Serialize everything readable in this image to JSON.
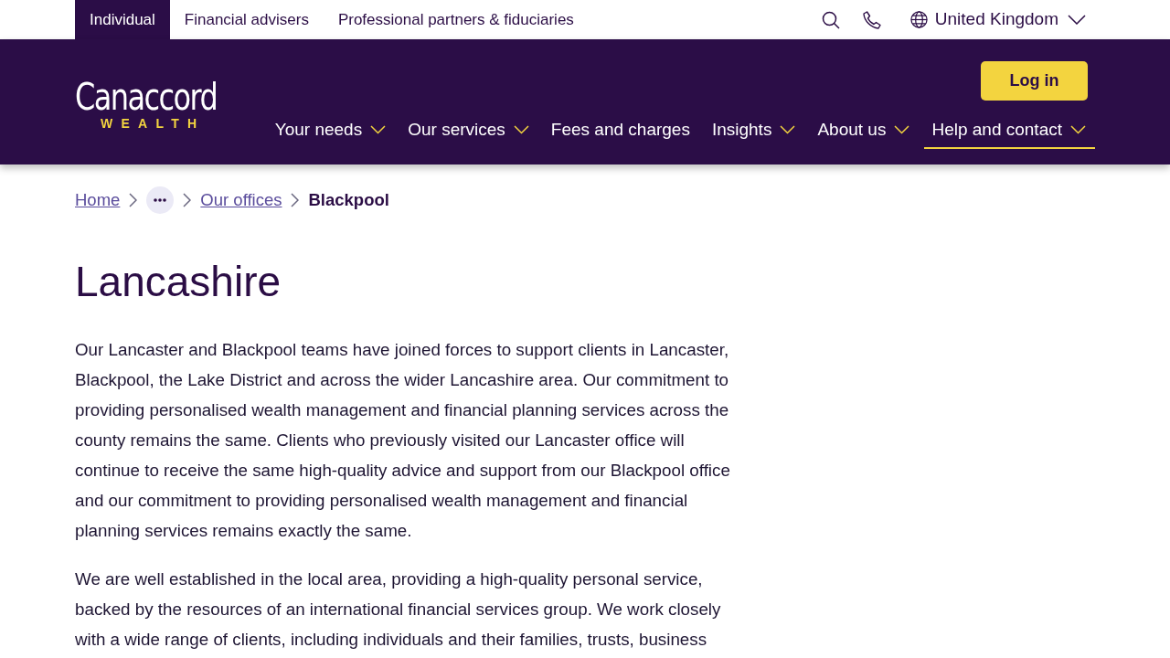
{
  "top_bar": {
    "segments": [
      {
        "label": "Individual",
        "selected": true
      },
      {
        "label": "Financial advisers",
        "selected": false
      },
      {
        "label": "Professional partners & fiduciaries",
        "selected": false
      }
    ],
    "region": "United Kingdom"
  },
  "header": {
    "logo": {
      "name": "Canaccord",
      "tagline": "WEALTH"
    },
    "login_button": "Log in",
    "nav": [
      {
        "label": "Your needs",
        "has_menu": true,
        "selected": false
      },
      {
        "label": "Our services",
        "has_menu": true,
        "selected": false
      },
      {
        "label": "Fees and charges",
        "has_menu": false,
        "selected": false
      },
      {
        "label": "Insights",
        "has_menu": true,
        "selected": false
      },
      {
        "label": "About us",
        "has_menu": true,
        "selected": false
      },
      {
        "label": "Help and contact",
        "has_menu": true,
        "selected": true
      }
    ]
  },
  "breadcrumb": [
    {
      "kind": "link",
      "label": "Home"
    },
    {
      "kind": "more"
    },
    {
      "kind": "link",
      "label": "Our offices"
    },
    {
      "kind": "current",
      "label": "Blackpool"
    }
  ],
  "page": {
    "title": "Lancashire",
    "paragraphs": [
      "Our Lancaster and Blackpool teams have joined forces to support clients in Lancaster, Blackpool, the Lake District and across the wider Lancashire area. Our commitment to providing personalised wealth management and financial planning services across the county remains the same. Clients who previously visited our Lancaster office will continue to receive the same high-quality advice and support from our Blackpool office and our commitment to providing personalised wealth management and financial planning services remains exactly the same.",
      "We are well established in the local area, providing a high-quality personal service, backed by the resources of an international financial services group. We work closely with a wide range of clients, including individuals and their families, trusts, business"
    ]
  }
}
